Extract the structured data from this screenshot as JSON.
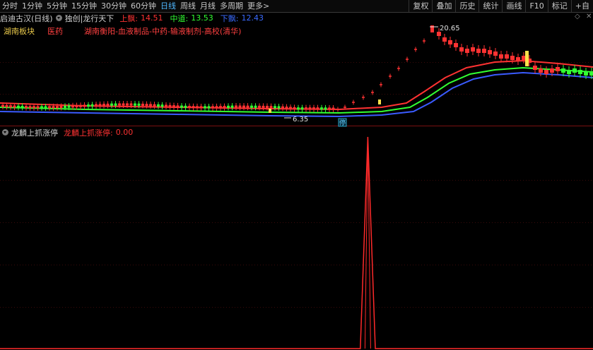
{
  "toolbar": {
    "periods": [
      "分时",
      "1分钟",
      "5分钟",
      "15分钟",
      "30分钟",
      "60分钟",
      "日线",
      "周线",
      "月线",
      "多周期",
      "更多>"
    ],
    "active_period": "日线",
    "right_buttons": [
      "复权",
      "叠加",
      "历史",
      "统计",
      "画线",
      "F10",
      "标记",
      "+自"
    ]
  },
  "main_chart": {
    "stock_title": "启迪古汉(日线)",
    "indicator_name": "独创|龙行天下",
    "upper_label": "上飘:",
    "upper_value": "14.51",
    "middle_label": "中道:",
    "middle_value": "13.53",
    "lower_label": "下飘:",
    "lower_value": "12.43",
    "sector_label": "湖南板块",
    "industry_label": "医药",
    "concepts": "湖南衡阳-血液制品-中药-输液制剂-高校(清华)",
    "high_label": "20.65",
    "low_label": "6.35",
    "stop_badge": "停",
    "colors": {
      "upper": "#ff3232",
      "middle": "#32ff32",
      "lower": "#3a5bff",
      "up_candle": "#ff3232",
      "down_candle": "#32ff32"
    }
  },
  "sub_chart": {
    "title": "龙麟上抓涨停",
    "value_label": "龙麟上抓涨停:",
    "value": "0.00"
  },
  "chart_data": {
    "type": "line",
    "x": [
      0,
      1,
      2,
      3,
      4,
      5,
      6,
      7,
      8,
      9,
      10,
      11,
      12,
      13,
      14,
      15,
      16,
      17,
      18,
      19,
      20,
      21,
      22,
      23,
      24,
      25,
      26,
      27,
      28,
      29,
      30,
      31,
      32,
      33,
      34,
      35,
      36,
      37,
      38,
      39,
      40,
      41,
      42,
      43,
      44,
      45,
      46,
      47,
      48,
      49,
      50,
      51,
      52,
      53,
      54,
      55,
      56,
      57,
      58,
      59,
      60,
      61,
      62,
      63,
      64,
      65,
      66,
      67,
      68,
      69,
      70,
      71,
      72,
      73,
      74,
      75,
      76,
      77,
      78,
      79
    ],
    "series": [
      {
        "name": "龙麟上抓涨停",
        "values": [
          0,
          0,
          0,
          0,
          0,
          0,
          0,
          0,
          0,
          0,
          0,
          0,
          0,
          0,
          0,
          0,
          0,
          0,
          0,
          0,
          0,
          0,
          0,
          0,
          0,
          0,
          0,
          0,
          0,
          0,
          0,
          0,
          0,
          0,
          0,
          0,
          0,
          0,
          0,
          0,
          0,
          0,
          0,
          0,
          0,
          0,
          0,
          0,
          0,
          0,
          0,
          0,
          0,
          0,
          0,
          0,
          0,
          0,
          0,
          0,
          0,
          0,
          0,
          0,
          0,
          0,
          0,
          0,
          0,
          0,
          0,
          0,
          0,
          0,
          0,
          0,
          0,
          0,
          0,
          0
        ],
        "spike_index": 49,
        "spike_value": 1
      }
    ],
    "ylim": [
      0,
      1
    ]
  }
}
